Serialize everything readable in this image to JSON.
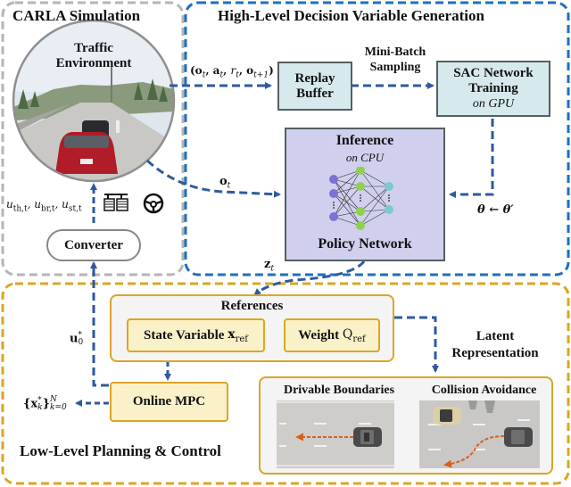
{
  "panels": {
    "carla": {
      "title": "CARLA Simulation",
      "border_color": "#b5b5b5"
    },
    "high_level": {
      "title": "High-Level Decision Variable Generation",
      "border_color": "#1f6fbf"
    },
    "low_level": {
      "title": "Low-Level Planning & Control",
      "border_color": "#dba625"
    }
  },
  "traffic_environment": {
    "line1": "Traffic",
    "line2": "Environment"
  },
  "converter": {
    "label": "Converter"
  },
  "control_inputs": {
    "label": "u_th,t , u_br,t , u_st,t",
    "icons": [
      "pedals-icon",
      "steering-wheel-icon"
    ]
  },
  "replay_buffer": {
    "line1": "Replay",
    "line2": "Buffer"
  },
  "transition_label": "(o_t, a_t, r_t, o_t+1)",
  "mini_batch": {
    "line1": "Mini-Batch",
    "line2": "Sampling"
  },
  "sac_training": {
    "line1": "SAC Network",
    "line2": "Training",
    "line3": "on GPU"
  },
  "inference": {
    "title": "Inference",
    "subtitle": "on CPU",
    "footer": "Policy Network"
  },
  "obs_label": "o_t",
  "param_update_label": "θ ← θ′",
  "latent_out_label": "z_t",
  "references": {
    "title": "References",
    "state_variable": "State Variable",
    "state_symbol": "x",
    "state_sub": "ref",
    "weight": "Weight",
    "weight_symbol": "Q",
    "weight_sub": "ref"
  },
  "online_mpc": {
    "label": "Online MPC"
  },
  "u0_label": {
    "base": "u",
    "sub": "0",
    "sup": "*"
  },
  "trajectory_label": {
    "text": "{x*_k}_k=0^N"
  },
  "latent_representation": {
    "line1": "Latent",
    "line2": "Representation"
  },
  "scenarios": [
    {
      "title": "Drivable Boundaries"
    },
    {
      "title": "Collision Avoidance"
    }
  ],
  "colors": {
    "arrow_blue": "#2d5aa0",
    "panel_blue": "#1f6fbf",
    "panel_gold": "#dba625",
    "panel_grey": "#b5b5b5",
    "box_cyan": "#d6eaee",
    "box_purple": "#d0d0ee",
    "box_yellow": "#fbf1c8",
    "trajectory_orange": "#d9601a"
  }
}
